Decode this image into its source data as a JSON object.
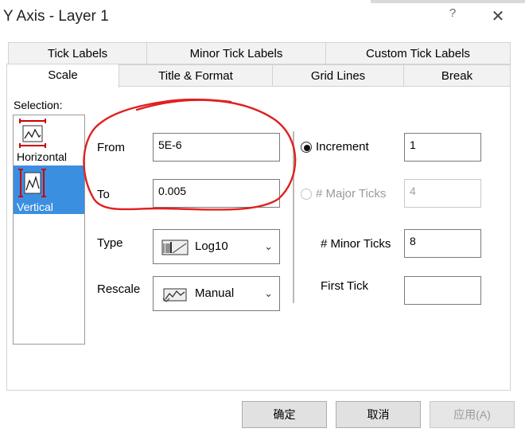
{
  "window": {
    "title": "Y Axis - Layer 1",
    "help": "?",
    "close": "✕"
  },
  "tabs": {
    "row1": [
      "Tick Labels",
      "Minor Tick Labels",
      "Custom Tick Labels"
    ],
    "row2": [
      "Scale",
      "Title & Format",
      "Grid Lines",
      "Break"
    ],
    "selected": "Scale"
  },
  "selection": {
    "label": "Selection:",
    "items": [
      {
        "label": "Horizontal",
        "icon": "horizontal-axis-icon",
        "selected": false
      },
      {
        "label": "Vertical",
        "icon": "vertical-axis-icon",
        "selected": true
      }
    ]
  },
  "scale": {
    "from_label": "From",
    "from_value": "5E-6",
    "to_label": "To",
    "to_value": "0.005",
    "type_label": "Type",
    "type_value": "Log10",
    "type_icon": "log-scale-icon",
    "rescale_label": "Rescale",
    "rescale_value": "Manual",
    "rescale_icon": "manual-rescale-icon",
    "increment_label": "Increment",
    "increment_value": "1",
    "increment_checked": true,
    "major_ticks_label": "# Major Ticks",
    "major_ticks_value": "4",
    "major_ticks_enabled": false,
    "minor_ticks_label": "# Minor Ticks",
    "minor_ticks_value": "8",
    "first_tick_label": "First Tick",
    "first_tick_value": ""
  },
  "buttons": {
    "ok": "确定",
    "cancel": "取消",
    "apply": "应用(A)"
  },
  "colors": {
    "selection_highlight": "#3b8fe0",
    "annotation": "#e02020"
  }
}
